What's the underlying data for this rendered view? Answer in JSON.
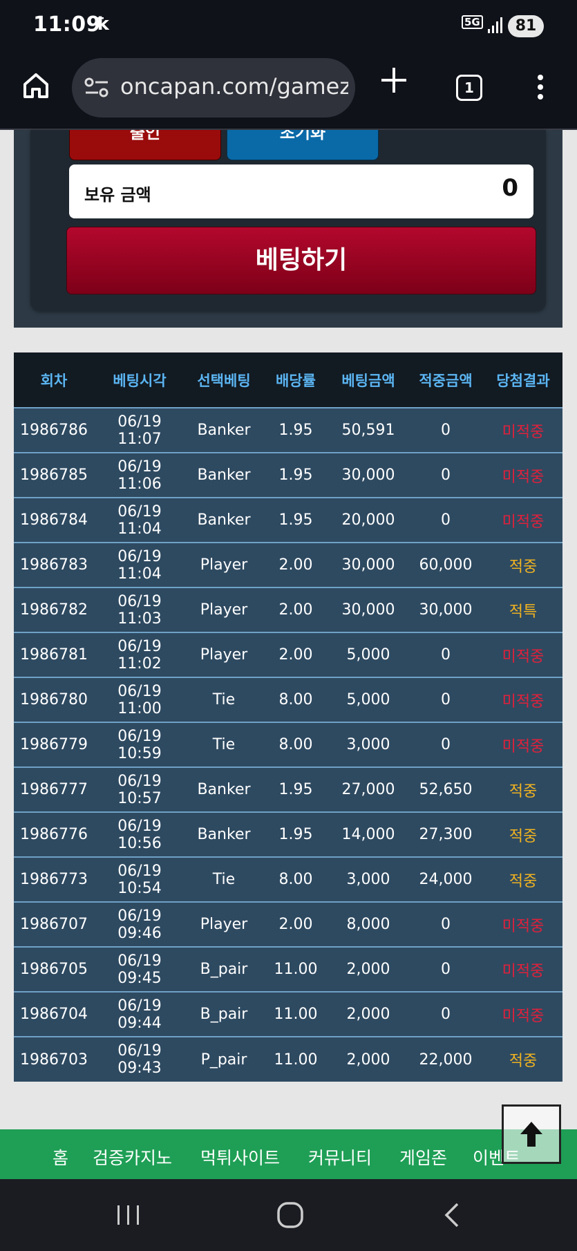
{
  "status": {
    "time": "11:09",
    "network_badge": "5G",
    "battery": "81"
  },
  "browser": {
    "url": "oncapan.com/gamez",
    "tab_count": "1"
  },
  "panel": {
    "withdraw_label": "출인",
    "reset_label": "초기화",
    "balance_label": "보유 금액",
    "balance_value": "0",
    "bet_button_label": "베팅하기"
  },
  "table": {
    "headers": [
      "회차",
      "베팅시각",
      "선택베팅",
      "배당률",
      "베팅금액",
      "적중금액",
      "당첨결과"
    ],
    "rows": [
      [
        "1986786",
        "06/19 11:07",
        "Banker",
        "1.95",
        "50,591",
        "0",
        "미적중"
      ],
      [
        "1986785",
        "06/19 11:06",
        "Banker",
        "1.95",
        "30,000",
        "0",
        "미적중"
      ],
      [
        "1986784",
        "06/19 11:04",
        "Banker",
        "1.95",
        "20,000",
        "0",
        "미적중"
      ],
      [
        "1986783",
        "06/19 11:04",
        "Player",
        "2.00",
        "30,000",
        "60,000",
        "적중"
      ],
      [
        "1986782",
        "06/19 11:03",
        "Player",
        "2.00",
        "30,000",
        "30,000",
        "적특"
      ],
      [
        "1986781",
        "06/19 11:02",
        "Player",
        "2.00",
        "5,000",
        "0",
        "미적중"
      ],
      [
        "1986780",
        "06/19 11:00",
        "Tie",
        "8.00",
        "5,000",
        "0",
        "미적중"
      ],
      [
        "1986779",
        "06/19 10:59",
        "Tie",
        "8.00",
        "3,000",
        "0",
        "미적중"
      ],
      [
        "1986777",
        "06/19 10:57",
        "Banker",
        "1.95",
        "27,000",
        "52,650",
        "적중"
      ],
      [
        "1986776",
        "06/19 10:56",
        "Banker",
        "1.95",
        "14,000",
        "27,300",
        "적중"
      ],
      [
        "1986773",
        "06/19 10:54",
        "Tie",
        "8.00",
        "3,000",
        "24,000",
        "적중"
      ],
      [
        "1986707",
        "06/19 09:46",
        "Player",
        "2.00",
        "8,000",
        "0",
        "미적중"
      ],
      [
        "1986705",
        "06/19 09:45",
        "B_pair",
        "11.00",
        "2,000",
        "0",
        "미적중"
      ],
      [
        "1986704",
        "06/19 09:44",
        "B_pair",
        "11.00",
        "2,000",
        "0",
        "미적중"
      ],
      [
        "1986703",
        "06/19 09:43",
        "P_pair",
        "11.00",
        "2,000",
        "22,000",
        "적중"
      ]
    ],
    "lose_color": "#e2203a",
    "win_color": "#f0b320"
  },
  "footer_nav": {
    "items": [
      "홈",
      "검증카지노",
      "먹튀사이트",
      "커뮤니티",
      "게임존",
      "이벤트"
    ]
  },
  "icons": {
    "home": "home-icon",
    "site_settings": "tune-icon",
    "new_tab": "plus-icon",
    "menu": "more-vert-icon",
    "scroll_top": "arrow-up-icon",
    "recents": "recents-icon",
    "android_home": "circle-home-icon",
    "back": "back-icon"
  }
}
